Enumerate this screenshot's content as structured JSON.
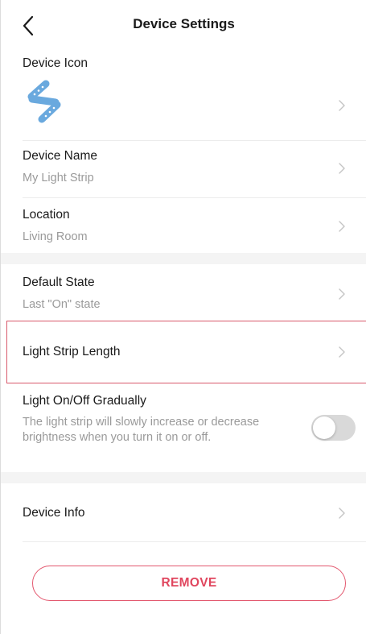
{
  "header": {
    "title": "Device Settings"
  },
  "icons": {
    "back": "chevron-left-icon",
    "row_arrow": "chevron-right-icon",
    "device": "light-strip-icon"
  },
  "rows": {
    "device_icon": {
      "label": "Device Icon"
    },
    "device_name": {
      "label": "Device Name",
      "value": "My Light Strip"
    },
    "location": {
      "label": "Location",
      "value": "Living Room"
    },
    "default_state": {
      "label": "Default State",
      "value": "Last \"On\" state"
    },
    "strip_length": {
      "label": "Light Strip Length"
    },
    "gradual": {
      "label": "Light On/Off Gradually",
      "description": "The light strip will slowly increase or decrease brightness when you turn it on or off.",
      "enabled": false
    },
    "device_info": {
      "label": "Device Info"
    }
  },
  "actions": {
    "remove_label": "REMOVE"
  },
  "colors": {
    "accent": "#e0465e",
    "highlight_border": "#d8596b",
    "icon_blue": "#6aa9de",
    "muted_text": "#9a9a9a",
    "section_gap": "#f4f4f4",
    "toggle_off": "#d9d9d9"
  }
}
